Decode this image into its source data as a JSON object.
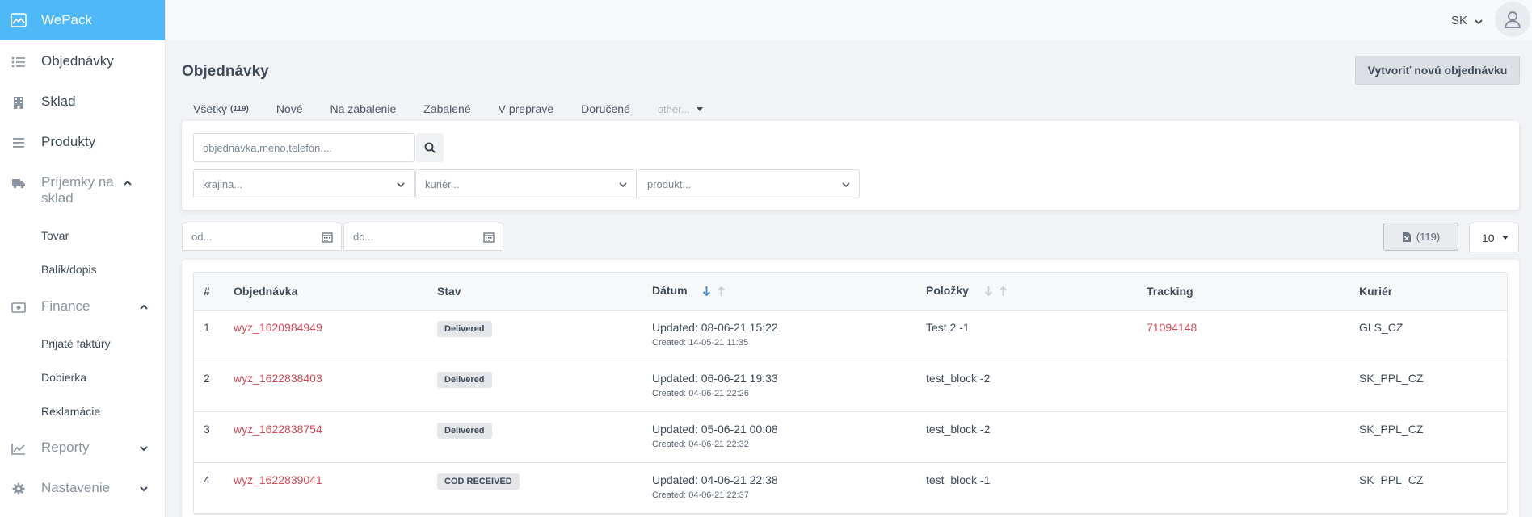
{
  "brand": {
    "name": "WePack"
  },
  "sidebar": {
    "items": [
      {
        "label": "Objednávky",
        "icon": "list-icon"
      },
      {
        "label": "Sklad",
        "icon": "building-icon"
      },
      {
        "label": "Produkty",
        "icon": "bars-icon"
      },
      {
        "label": "Príjemky na sklad",
        "icon": "truck-icon"
      },
      {
        "label": "Tovar"
      },
      {
        "label": "Balík/dopis"
      },
      {
        "label": "Finance",
        "icon": "money-icon"
      },
      {
        "label": "Prijaté faktúry"
      },
      {
        "label": "Dobierka"
      },
      {
        "label": "Reklamácie"
      },
      {
        "label": "Reporty",
        "icon": "chart-line-icon"
      },
      {
        "label": "Nastavenie",
        "icon": "gear-icon"
      }
    ]
  },
  "header": {
    "language": "SK"
  },
  "page": {
    "title": "Objednávky",
    "create_button": "Vytvoriť novú objednávku"
  },
  "tabs": [
    {
      "label": "Všetky",
      "count": "(119)"
    },
    {
      "label": "Nové"
    },
    {
      "label": "Na zabalenie"
    },
    {
      "label": "Zabalené"
    },
    {
      "label": "V preprave"
    },
    {
      "label": "Doručené"
    },
    {
      "label": "other..."
    }
  ],
  "filters": {
    "search_placeholder": "objednávka,meno,telefón....",
    "country_placeholder": "krajina...",
    "courier_placeholder": "kuriér...",
    "product_placeholder": "produkt...",
    "date_from_placeholder": "od...",
    "date_to_placeholder": "do...",
    "export_count": "(119)",
    "per_page": "10"
  },
  "table": {
    "headers": {
      "num": "#",
      "order": "Objednávka",
      "status": "Stav",
      "date": "Dátum",
      "items": "Položky",
      "tracking": "Tracking",
      "courier": "Kuriér"
    },
    "rows": [
      {
        "num": "1",
        "order": "wyz_1620984949",
        "status": "Delivered",
        "updated": "Updated: 08-06-21 15:22",
        "created_label": "Created:",
        "created": "14-05-21 11:35",
        "items": "Test 2 -1",
        "tracking": "71094148",
        "courier": "GLS_CZ"
      },
      {
        "num": "2",
        "order": "wyz_1622838403",
        "status": "Delivered",
        "updated": "Updated: 06-06-21 19:33",
        "created_label": "Created:",
        "created": "04-06-21 22:26",
        "items": "test_block -2",
        "tracking": "",
        "courier": "SK_PPL_CZ"
      },
      {
        "num": "3",
        "order": "wyz_1622838754",
        "status": "Delivered",
        "updated": "Updated: 05-06-21 00:08",
        "created_label": "Created:",
        "created": "04-06-21 22:32",
        "items": "test_block -2",
        "tracking": "",
        "courier": "SK_PPL_CZ"
      },
      {
        "num": "4",
        "order": "wyz_1622839041",
        "status": "COD RECEIVED",
        "updated": "Updated: 04-06-21 22:38",
        "created_label": "Created:",
        "created": "04-06-21 22:37",
        "items": "test_block -1",
        "tracking": "",
        "courier": "SK_PPL_CZ"
      }
    ]
  },
  "colors": {
    "brand": "#4fb9f7",
    "link": "#d04a55",
    "sort_active": "#3a86c8"
  }
}
